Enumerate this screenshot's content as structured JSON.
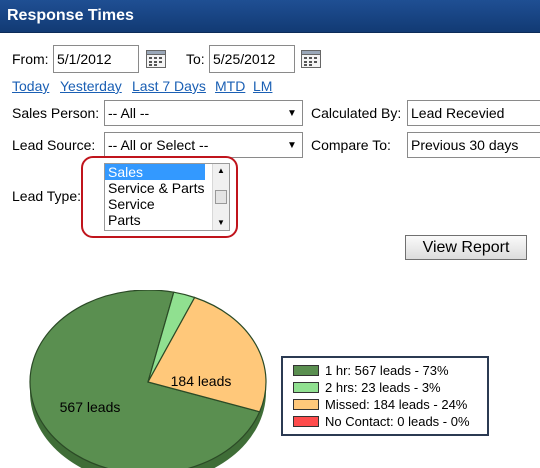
{
  "panel": {
    "title": "Response Times"
  },
  "dates": {
    "from_label": "From:",
    "from_value": "5/1/2012",
    "to_label": "To:",
    "to_value": "5/25/2012"
  },
  "quick_ranges": [
    "Today",
    "Yesterday",
    "Last 7 Days",
    "MTD",
    "LM"
  ],
  "filters": {
    "sales_person_label": "Sales Person:",
    "sales_person_value": "-- All --",
    "lead_source_label": "Lead Source:",
    "lead_source_value": "-- All or Select --",
    "calculated_by_label": "Calculated By:",
    "calculated_by_value": "Lead Recevied",
    "compare_to_label": "Compare To:",
    "compare_to_value": "Previous 30 days",
    "lead_type_label": "Lead Type:",
    "lead_type_options": [
      "Sales",
      "Service & Parts",
      "Service",
      "Parts"
    ],
    "lead_type_selected": "Sales"
  },
  "view_report_label": "View Report",
  "colors": {
    "title_bar": "#1a4585",
    "link": "#1a5fb4",
    "highlight_ring": "#c0141c",
    "one_hr": "#5a8f50",
    "two_hrs": "#90e090",
    "missed": "#ffc87a",
    "no_contact": "#ff4c4c"
  },
  "chart_data": {
    "type": "pie",
    "slices": [
      {
        "label": "1 hr",
        "leads": 567,
        "percent": 73,
        "color": "#5a8f50"
      },
      {
        "label": "2 hrs",
        "leads": 23,
        "percent": 3,
        "color": "#90e090"
      },
      {
        "label": "Missed",
        "leads": 184,
        "percent": 24,
        "color": "#ffc87a"
      },
      {
        "label": "No Contact",
        "leads": 0,
        "percent": 0,
        "color": "#ff4c4c"
      }
    ],
    "slice_labels": [
      "567 leads",
      "184 leads"
    ],
    "legend": [
      "1 hr: 567 leads - 73%",
      "2 hrs: 23 leads - 3%",
      "Missed: 184 leads - 24%",
      "No Contact: 0 leads - 0%"
    ],
    "legend_position": "right"
  }
}
